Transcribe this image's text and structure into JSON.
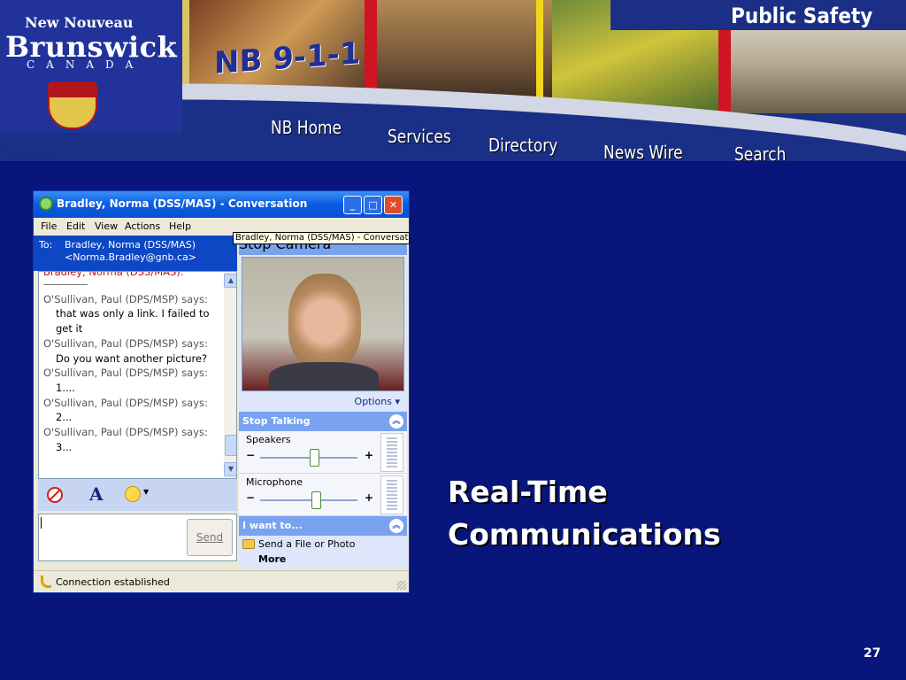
{
  "banner": {
    "logo": {
      "top": "New Nouveau",
      "main": "Brunswick",
      "sub": "CANADA"
    },
    "title": "NB 9-1-1",
    "section": "Public Safety",
    "nav": {
      "home": "NB Home",
      "services": "Services",
      "directory": "Directory",
      "news": "News Wire",
      "search": "Search"
    }
  },
  "messenger": {
    "title": "Bradley, Norma  (DSS/MAS) - Conversation",
    "menu": {
      "file": "File",
      "edit": "Edit",
      "view": "View",
      "actions": "Actions",
      "help": "Help"
    },
    "to": {
      "label": "To:",
      "name": "Bradley, Norma  (DSS/MAS)",
      "email": "<Norma.Bradley@gnb.ca>"
    },
    "conversation": {
      "cut_line": "Bradley, Norma  (DSS/MAS):",
      "messages": [
        {
          "sender": "O'Sullivan, Paul (DPS/MSP) says:",
          "text": "that was only a link.  I failed to get it"
        },
        {
          "sender": "O'Sullivan, Paul (DPS/MSP) says:",
          "text": "Do you want another picture?"
        },
        {
          "sender": "O'Sullivan, Paul (DPS/MSP) says:",
          "text": "1...."
        },
        {
          "sender": "O'Sullivan, Paul (DPS/MSP) says:",
          "text": "2..."
        },
        {
          "sender": "O'Sullivan, Paul (DPS/MSP) says:",
          "text": "3..."
        }
      ]
    },
    "format_icons": [
      "block-icon",
      "font-icon",
      "emoticon-icon"
    ],
    "font_glyph": "A",
    "send_label": "Send",
    "tooltip": "Bradley, Norma  (DSS/MAS) - Conversation",
    "camera": {
      "header": "Stop Camera",
      "options": "Options ▾"
    },
    "talk": {
      "header": "Stop Talking",
      "speakers_label": "Speakers",
      "microphone_label": "Microphone",
      "speaker_level": 0.55,
      "mic_level": 0.57
    },
    "want": {
      "header": "I want to...",
      "send_file": "Send a File or Photo",
      "more": "More"
    },
    "status": "Connection established"
  },
  "slide": {
    "title_line1": "Real-Time",
    "title_line2": "Communications",
    "number": "27"
  },
  "colors": {
    "background": "#08157a",
    "titlebar": "#0a5ce0",
    "accent": "#7aa3ef"
  }
}
